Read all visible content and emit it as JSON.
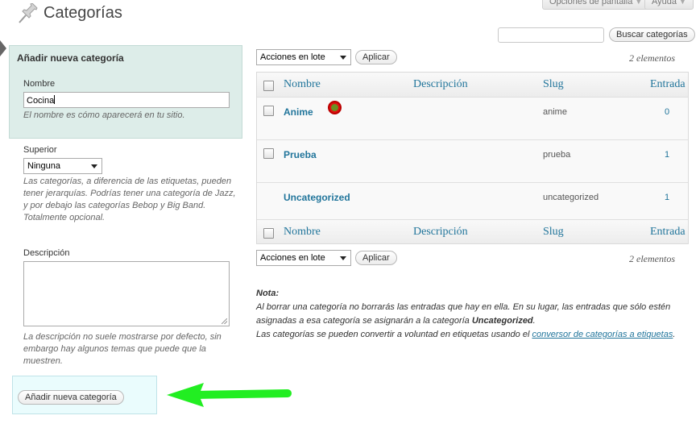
{
  "header": {
    "title": "Categorías",
    "screen_options": "Opciones de pantalla",
    "help": "Ayuda"
  },
  "search": {
    "value": "",
    "button": "Buscar categorías"
  },
  "form": {
    "title": "Añadir nueva categoría",
    "name_label": "Nombre",
    "name_value": "Cocina",
    "name_help": "El nombre es cómo aparecerá en tu sitio.",
    "parent_label": "Superior",
    "parent_value": "Ninguna",
    "parent_help": "Las categorías, a diferencia de las etiquetas, pueden tener jerarquías. Podrías tener una categoría de Jazz, y por debajo las categorías Bebop y Big Band. Totalmente opcional.",
    "description_label": "Descripción",
    "description_value": "",
    "description_help": "La descripción no suele mostrarse por defecto, sin embargo hay algunos temas que puede que la muestren.",
    "submit": "Añadir nueva categoría"
  },
  "bulk": {
    "select_value": "Acciones en lote",
    "apply": "Aplicar",
    "count": "2 elementos"
  },
  "table": {
    "columns": [
      "Nombre",
      "Descripción",
      "Slug",
      "Entrada"
    ],
    "rows": [
      {
        "name": "Anime",
        "description": "",
        "slug": "anime",
        "count": "0"
      },
      {
        "name": "Prueba",
        "description": "",
        "slug": "prueba",
        "count": "1"
      },
      {
        "name": "Uncategorized",
        "description": "",
        "slug": "uncategorized",
        "count": "1"
      }
    ]
  },
  "note": {
    "heading": "Nota:",
    "line1_pre": "Al borrar una categoría no borrarás las entradas que hay en ella. En su lugar, las entradas que sólo estén asignadas a esa categoría se asignarán a la categoría ",
    "line1_bold": "Uncategorized",
    "line1_post": ".",
    "line2_pre": "Las categorías se pueden convertir a voluntad en etiquetas usando el ",
    "line2_link": "conversor de categorías a etiquetas",
    "line2_post": "."
  },
  "colors": {
    "link": "#21759b",
    "form_box": "#ddede9",
    "submit_box": "#eafcfd",
    "annotation_arrow": "#22ee22",
    "annotation_dot": "#e01010"
  }
}
